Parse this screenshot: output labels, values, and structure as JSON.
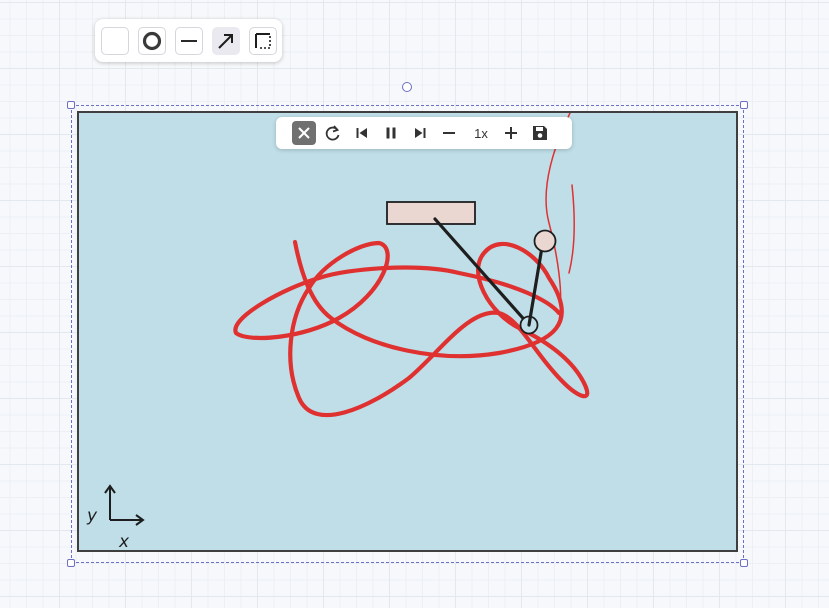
{
  "style_toolbar": {
    "buttons": [
      {
        "icon": "blank-fill-icon",
        "active": false
      },
      {
        "icon": "stroke-circle-icon",
        "active": false
      },
      {
        "icon": "line-icon",
        "active": false
      },
      {
        "icon": "arrow-icon",
        "active": true
      },
      {
        "icon": "dashed-box-icon",
        "active": false
      }
    ]
  },
  "playback": {
    "buttons": [
      "stop-icon",
      "restart-icon",
      "step-back-icon",
      "pause-icon",
      "step-forward-icon",
      "minus-icon"
    ],
    "speed": "1x",
    "extra_buttons": [
      "plus-icon",
      "save-icon"
    ]
  },
  "scene": {
    "background": "#bfdee8",
    "trace_color": "#e03131",
    "pendulum_color": "#1e1e1e",
    "pivot_fill": "#ead7d2",
    "axes": {
      "x_label": "x",
      "y_label": "y"
    }
  },
  "colors": {
    "selection": "#6c6fc4"
  }
}
